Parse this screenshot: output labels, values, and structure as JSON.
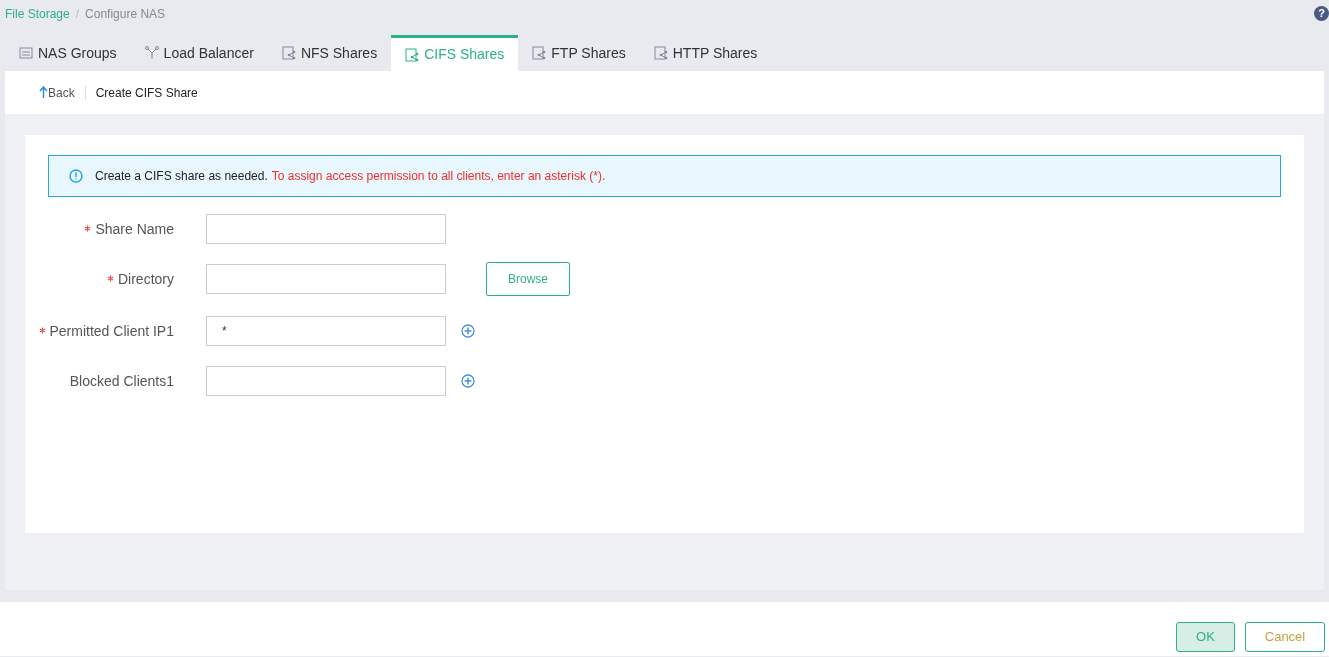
{
  "breadcrumb": [
    {
      "label": "File Storage",
      "link": true
    },
    {
      "label": "Configure NAS",
      "link": false
    }
  ],
  "breadcrumb_separator": "/",
  "help": "?",
  "tabs": [
    {
      "label": "NAS Groups",
      "kind": "device",
      "selected": false
    },
    {
      "label": "Load Balancer",
      "kind": "balancer",
      "selected": false
    },
    {
      "label": "NFS Shares",
      "kind": "share",
      "selected": false
    },
    {
      "label": "CIFS Shares",
      "kind": "share",
      "selected": true
    },
    {
      "label": "FTP Shares",
      "kind": "share",
      "selected": false
    },
    {
      "label": "HTTP Shares",
      "kind": "share",
      "selected": false
    }
  ],
  "toolbar": {
    "back": "Back",
    "title": "Create CIFS Share"
  },
  "info": {
    "text": "Create a CIFS share as needed.",
    "warning": "To assign access permission to all clients, enter an asterisk (*)."
  },
  "fields": [
    {
      "label": "Share Name",
      "required": true,
      "kind": "text"
    },
    {
      "label": "Directory",
      "required": true,
      "kind": "browse",
      "button": "Browse"
    },
    {
      "label": "Permitted Client IP1",
      "required": true,
      "value": "*",
      "kind": "add"
    },
    {
      "label": "Blocked Clients1",
      "required": false,
      "kind": "add"
    }
  ],
  "footer": {
    "ok": "OK",
    "cancel": "Cancel"
  }
}
